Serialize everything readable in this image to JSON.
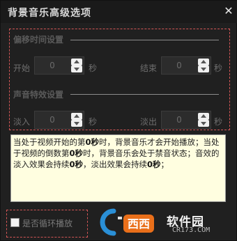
{
  "window": {
    "title": "背景音乐高级选项",
    "close_symbol": "✕"
  },
  "offset_section": {
    "title": "偏移时间设置",
    "start": {
      "label": "开始",
      "value": "0",
      "unit": "秒"
    },
    "end": {
      "label": "结束",
      "value": "0",
      "unit": "秒"
    }
  },
  "audio_section": {
    "title": "声音特效设置",
    "fade_in": {
      "label": "淡入",
      "value": "0",
      "unit": "秒"
    },
    "fade_out": {
      "label": "淡出",
      "value": "0",
      "unit": "秒"
    }
  },
  "info": {
    "p1": "当处于视频开始的第",
    "b1": "0秒",
    "p2": "时，背景音乐才会开始播放；当处于视频的倒数第",
    "b2": "0秒",
    "p3": "时，背景音乐会处于禁音状态；音效的淡入效果会持续",
    "b3": "0秒",
    "p4": "，淡出效果会持续",
    "b4": "0秒",
    "p5": "；"
  },
  "loop": {
    "label": "是否循环播放",
    "checked": false
  },
  "watermark": {
    "logo_text": "西西",
    "name": "软件园",
    "url": "CR173.COM"
  },
  "colors": {
    "accent_dash": "#d45656",
    "info_bg": "#fffee0"
  }
}
